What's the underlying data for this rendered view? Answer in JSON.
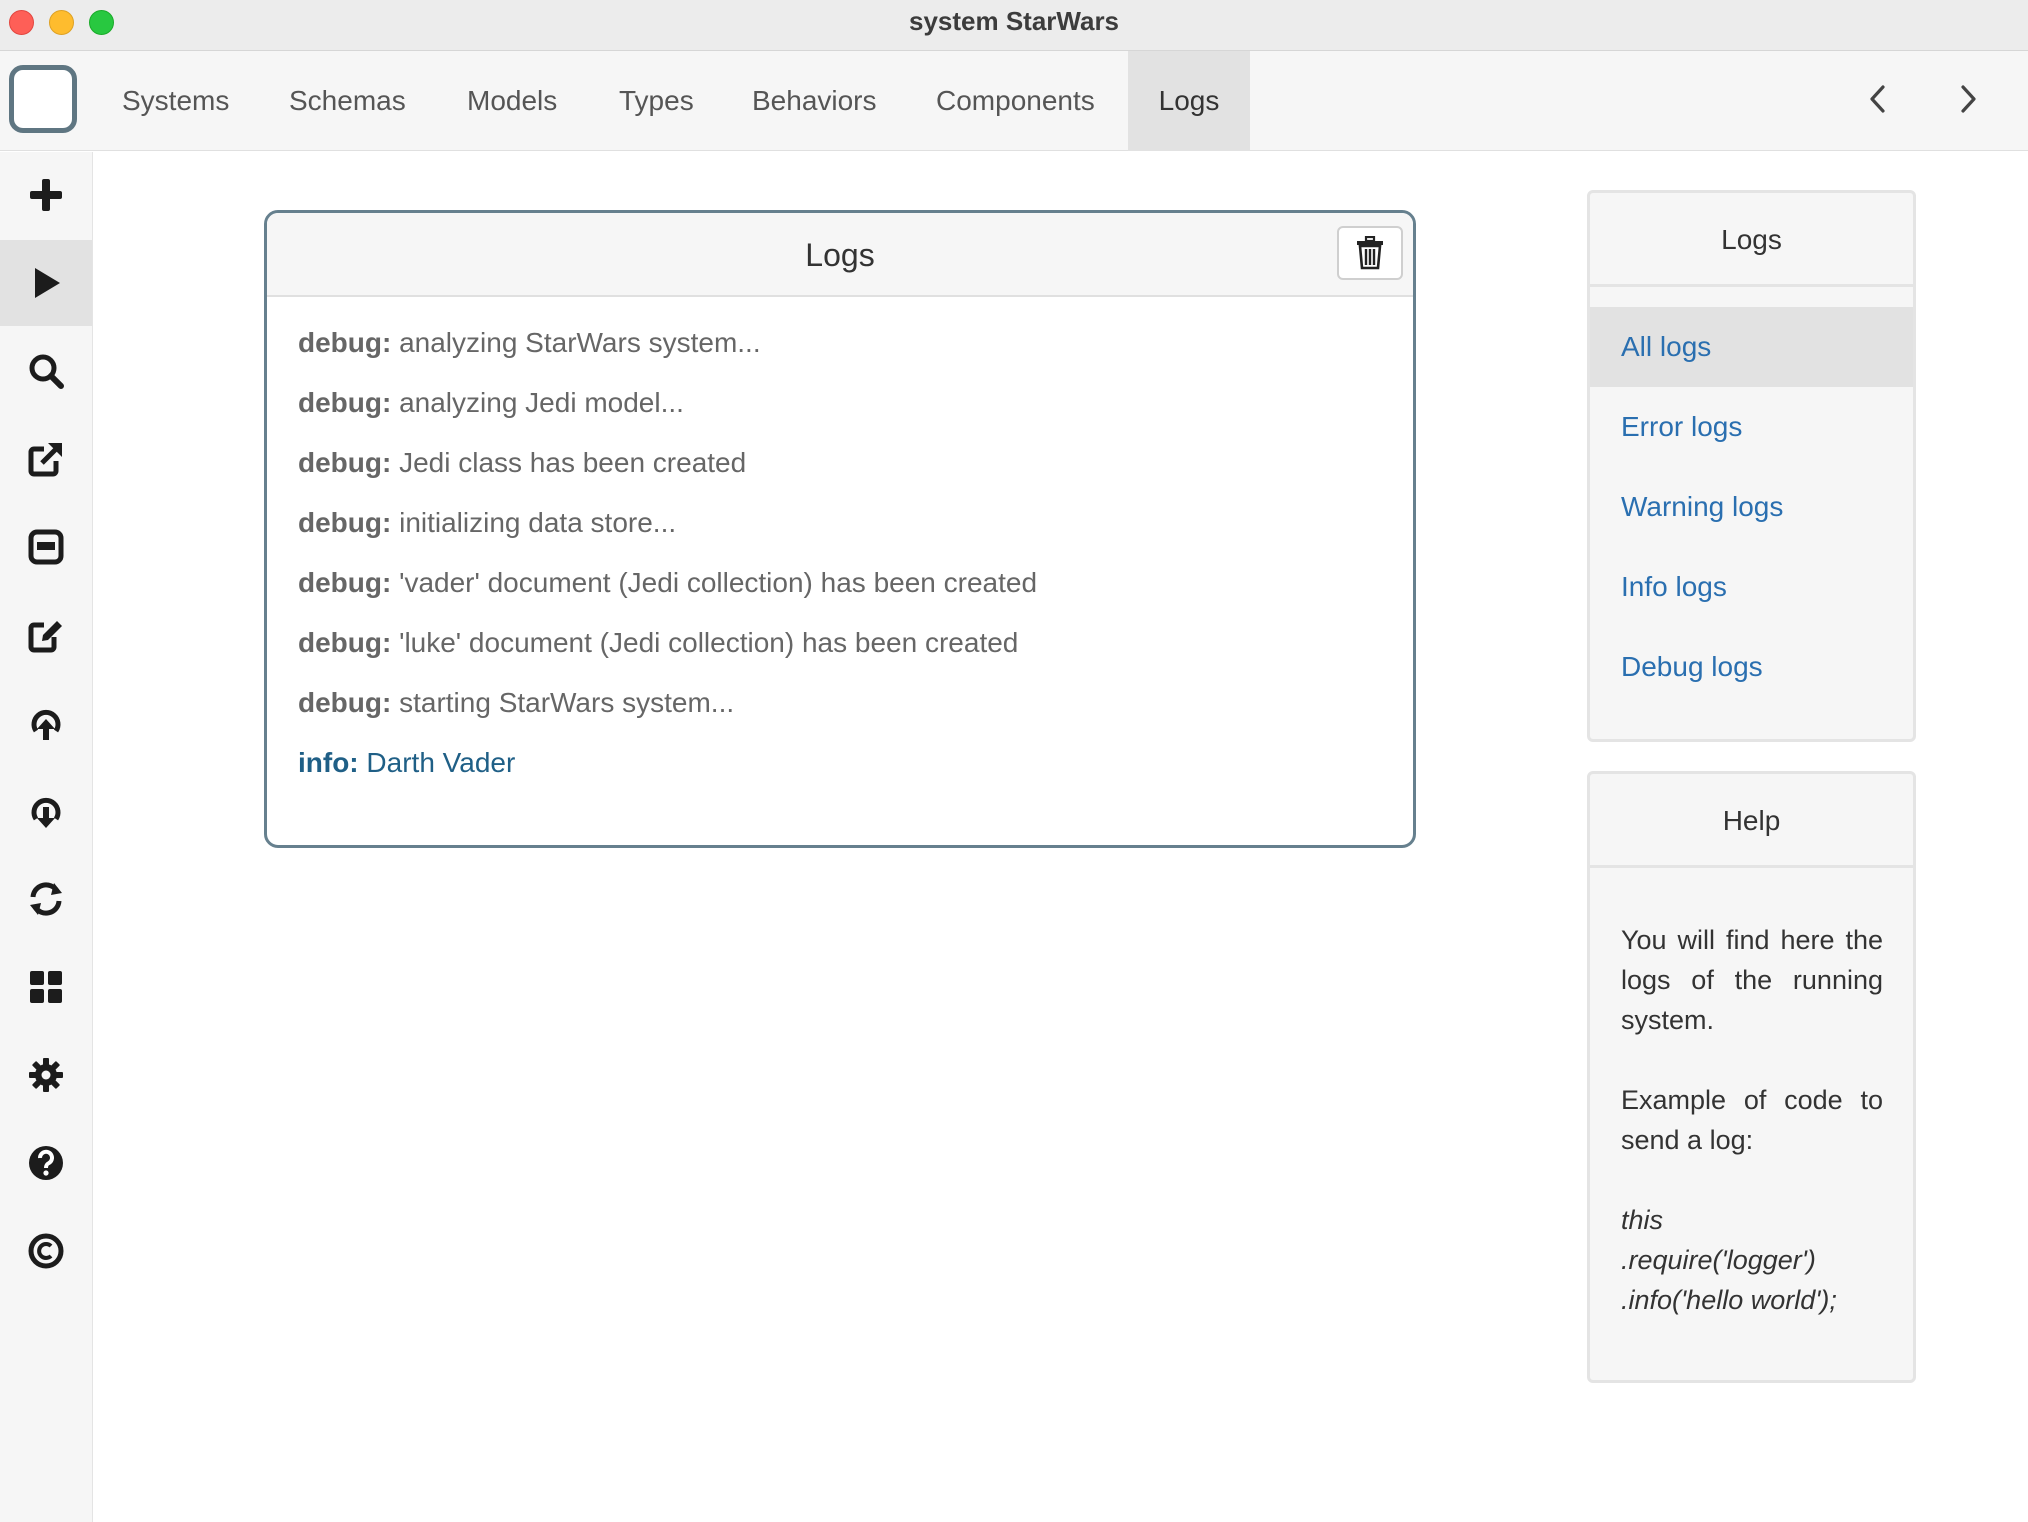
{
  "window": {
    "title": "system StarWars"
  },
  "topnav": {
    "tabs": [
      "Systems",
      "Schemas",
      "Models",
      "Types",
      "Behaviors",
      "Components",
      "Logs"
    ],
    "active_tab": "Logs"
  },
  "sidebar": {
    "icons": [
      "plus-icon",
      "play-icon",
      "search-icon",
      "external-edit-icon",
      "window-icon",
      "edit-icon",
      "upload-icon",
      "download-icon",
      "refresh-icon",
      "grid-icon",
      "gear-icon",
      "help-icon",
      "copyright-icon"
    ],
    "active": "play-icon"
  },
  "logs_panel": {
    "title": "Logs",
    "entries": [
      {
        "level": "debug:",
        "message": "analyzing StarWars system..."
      },
      {
        "level": "debug:",
        "message": "analyzing Jedi model..."
      },
      {
        "level": "debug:",
        "message": "Jedi class has been created"
      },
      {
        "level": "debug:",
        "message": "initializing data store..."
      },
      {
        "level": "debug:",
        "message": "'vader' document (Jedi collection) has been created"
      },
      {
        "level": "debug:",
        "message": "'luke' document (Jedi collection) has been created"
      },
      {
        "level": "debug:",
        "message": "starting StarWars system..."
      },
      {
        "level": "info:",
        "message": "Darth Vader"
      }
    ]
  },
  "logs_menu": {
    "title": "Logs",
    "items": [
      "All logs",
      "Error logs",
      "Warning logs",
      "Info logs",
      "Debug logs"
    ],
    "active": "All logs"
  },
  "help": {
    "title": "Help",
    "text1": "You will find here the logs of the running system.",
    "text2": "Example of code to send a log:",
    "code": [
      "this",
      ".require('logger')",
      ".info('hello world');"
    ]
  },
  "colors": {
    "accent_link": "#2a6fb0",
    "info_text": "#1f5f86",
    "panel_border": "#66808e"
  }
}
